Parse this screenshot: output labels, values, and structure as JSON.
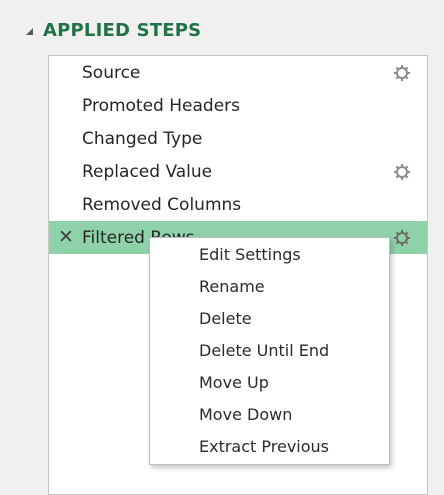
{
  "applied_steps": {
    "title": "APPLIED STEPS",
    "steps": [
      {
        "label": "Source",
        "has_settings": true
      },
      {
        "label": "Promoted Headers",
        "has_settings": false
      },
      {
        "label": "Changed Type",
        "has_settings": false
      },
      {
        "label": "Replaced Value",
        "has_settings": true
      },
      {
        "label": "Removed Columns",
        "has_settings": false
      },
      {
        "label": "Filtered Rows",
        "has_settings": true,
        "selected": true
      }
    ]
  },
  "context_menu": {
    "items": [
      {
        "label": "Edit Settings"
      },
      {
        "label": "Rename"
      },
      {
        "label": "Delete"
      },
      {
        "label": "Delete Until End"
      },
      {
        "label": "Move Up"
      },
      {
        "label": "Move Down"
      },
      {
        "label": "Extract Previous"
      }
    ]
  },
  "colors": {
    "accent": "#217346",
    "selected_row": "#8fd2a9"
  },
  "icons": {
    "collapse": "triangle-collapse-icon",
    "settings": "gear-icon",
    "delete": "close-icon"
  }
}
